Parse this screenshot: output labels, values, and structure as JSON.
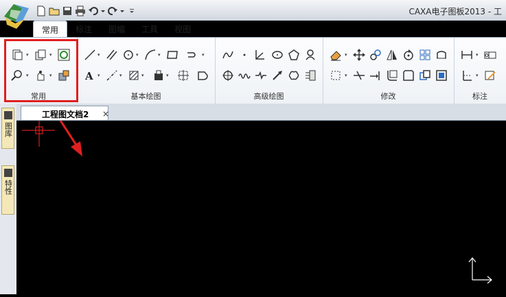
{
  "app": {
    "title": "CAXA电子图板2013 - 工",
    "logo_icon": "caxa-logo-icon"
  },
  "quick_access": [
    "new-icon",
    "open-icon",
    "save-icon",
    "print-icon",
    "undo-icon",
    "redo-icon",
    "customize-icon"
  ],
  "tabs": [
    {
      "label": "常用",
      "active": true
    },
    {
      "label": "标注",
      "active": false
    },
    {
      "label": "图幅",
      "active": false
    },
    {
      "label": "工具",
      "active": false
    },
    {
      "label": "视图",
      "active": false
    }
  ],
  "ribbon_groups": {
    "common": "常用",
    "basic_draw": "基本绘图",
    "advanced_draw": "高级绘图",
    "modify": "修改",
    "annotate": "标注"
  },
  "left_panel": {
    "library_label": "图库",
    "properties_label": "特性"
  },
  "document": {
    "tab_label": "工程图文档2",
    "close": "×"
  },
  "colors": {
    "highlight": "#e01f1f",
    "canvas": "#000000",
    "crosshair": "#d02020"
  }
}
